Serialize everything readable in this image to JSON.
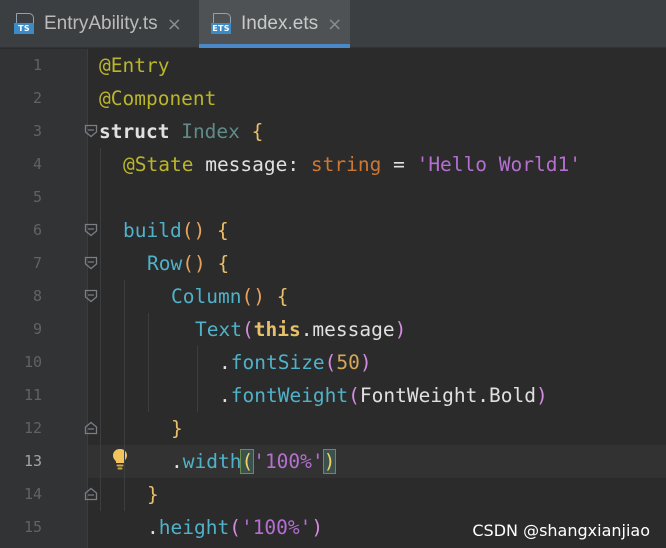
{
  "tabs": [
    {
      "label": "EntryAbility.ts",
      "icon_text": "TS",
      "icon": "typescript-file-icon",
      "active": false
    },
    {
      "label": "Index.ets",
      "icon_text": "ETS",
      "icon": "ets-file-icon",
      "active": true
    }
  ],
  "close_glyph": "×",
  "editor": {
    "current_line": 13,
    "line_numbers": [
      "1",
      "2",
      "3",
      "4",
      "5",
      "6",
      "7",
      "8",
      "9",
      "10",
      "11",
      "12",
      "13",
      "14",
      "15"
    ]
  },
  "code": {
    "l1": {
      "a": "@Entry"
    },
    "l2": {
      "a": "@Component"
    },
    "l3": {
      "kw": "struct",
      "name": "Index",
      "brace": "{"
    },
    "l4": {
      "ann": "@State",
      "id": "message:",
      "type": "string",
      "eq": "=",
      "str": "'Hello World1'"
    },
    "l6": {
      "fn": "build",
      "par": "()",
      "brace": "{"
    },
    "l7": {
      "fn": "Row",
      "par": "()",
      "brace": "{"
    },
    "l8": {
      "fn": "Column",
      "par": "()",
      "brace": "{"
    },
    "l9": {
      "fn": "Text",
      "open": "(",
      "this": "this",
      "rest": ".message",
      "close": ")"
    },
    "l10": {
      "dot": ".",
      "fn": "fontSize",
      "open": "(",
      "num": "50",
      "close": ")"
    },
    "l11": {
      "dot": ".",
      "fn": "fontWeight",
      "open": "(",
      "arg": "FontWeight.Bold",
      "close": ")"
    },
    "l12": {
      "brace": "}"
    },
    "l13": {
      "dot": ".",
      "fn": "width",
      "open": "(",
      "str": "'100%'",
      "close": ")"
    },
    "l14": {
      "brace": "}"
    },
    "l15": {
      "dot": ".",
      "fn": "height",
      "open": "(",
      "str": "'100%'",
      "close": ")"
    }
  },
  "watermark": "CSDN @shangxianjiao"
}
